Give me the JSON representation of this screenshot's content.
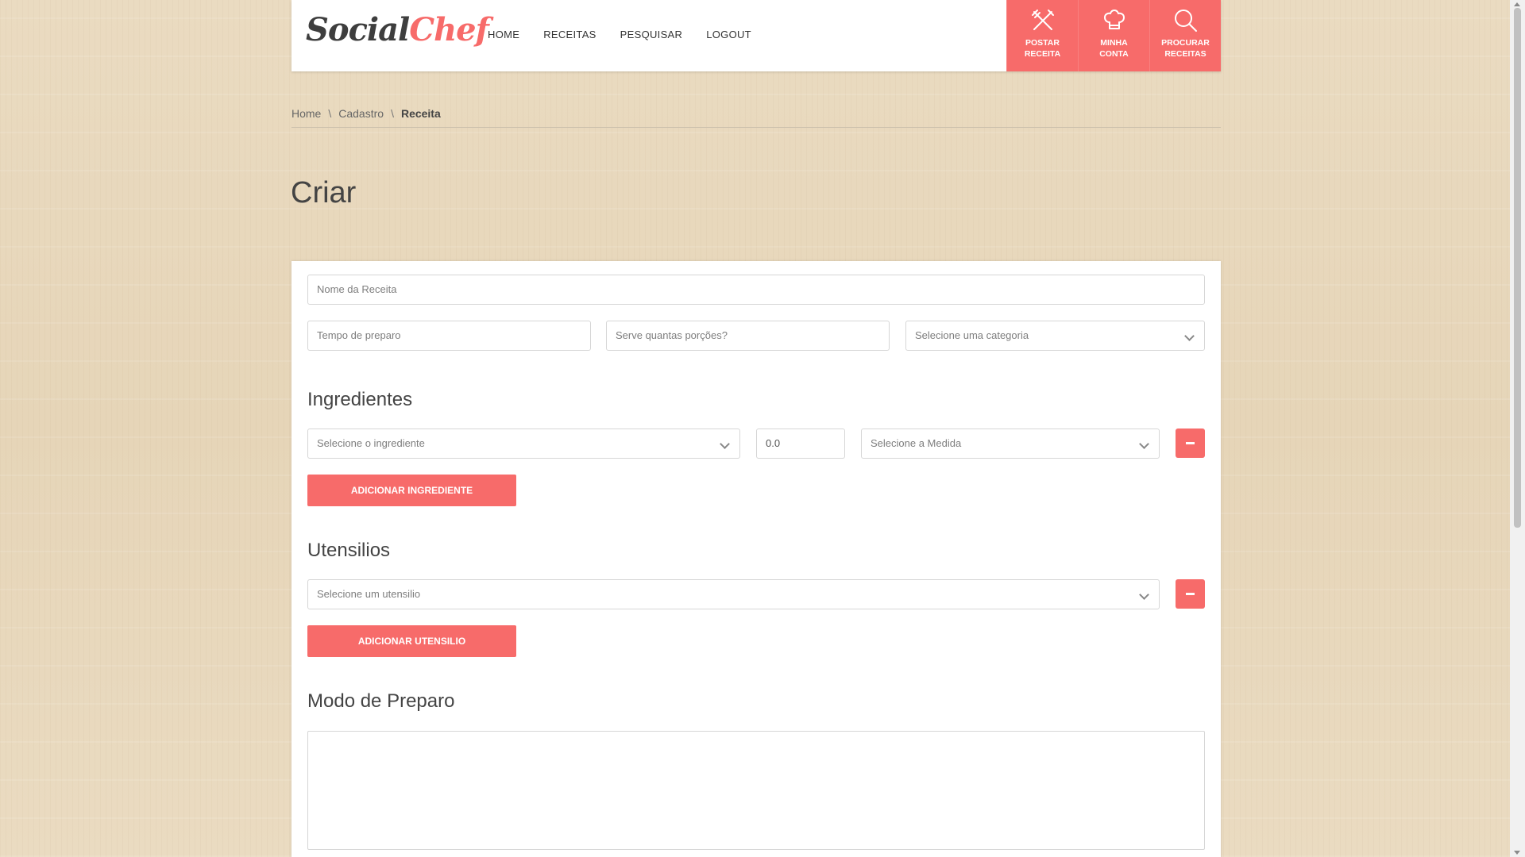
{
  "brand": {
    "part1": "Social",
    "part2": "Chef"
  },
  "nav": [
    "HOME",
    "RECEITAS",
    "PESQUISAR",
    "LOGOUT"
  ],
  "actions": [
    {
      "label1": "POSTAR",
      "label2": "RECEITA",
      "icon": "utensils-icon"
    },
    {
      "label1": "MINHA",
      "label2": "CONTA",
      "icon": "chef-hat-icon"
    },
    {
      "label1": "PROCURAR",
      "label2": "RECEITAS",
      "icon": "search-icon"
    }
  ],
  "breadcrumb": [
    "Home",
    "Cadastro",
    "Receita"
  ],
  "page_title": "Criar",
  "form": {
    "name_placeholder": "Nome da Receita",
    "time_placeholder": "Tempo de preparo",
    "servings_placeholder": "Serve quantas porções?",
    "category_placeholder": "Selecione uma categoria",
    "ingredients_heading": "Ingredientes",
    "ingredient_select": "Selecione o ingrediente",
    "quantity_value": "0.0",
    "measure_select": "Selecione a Medida",
    "add_ingredient": "ADICIONAR INGREDIENTE",
    "utensils_heading": "Utensilios",
    "utensil_select": "Selecione um utensilio",
    "add_utensil": "ADICIONAR UTENSILIO",
    "method_heading": "Modo de Preparo"
  },
  "colors": {
    "accent": "#f76b6a",
    "background": "#e8d8bc"
  }
}
